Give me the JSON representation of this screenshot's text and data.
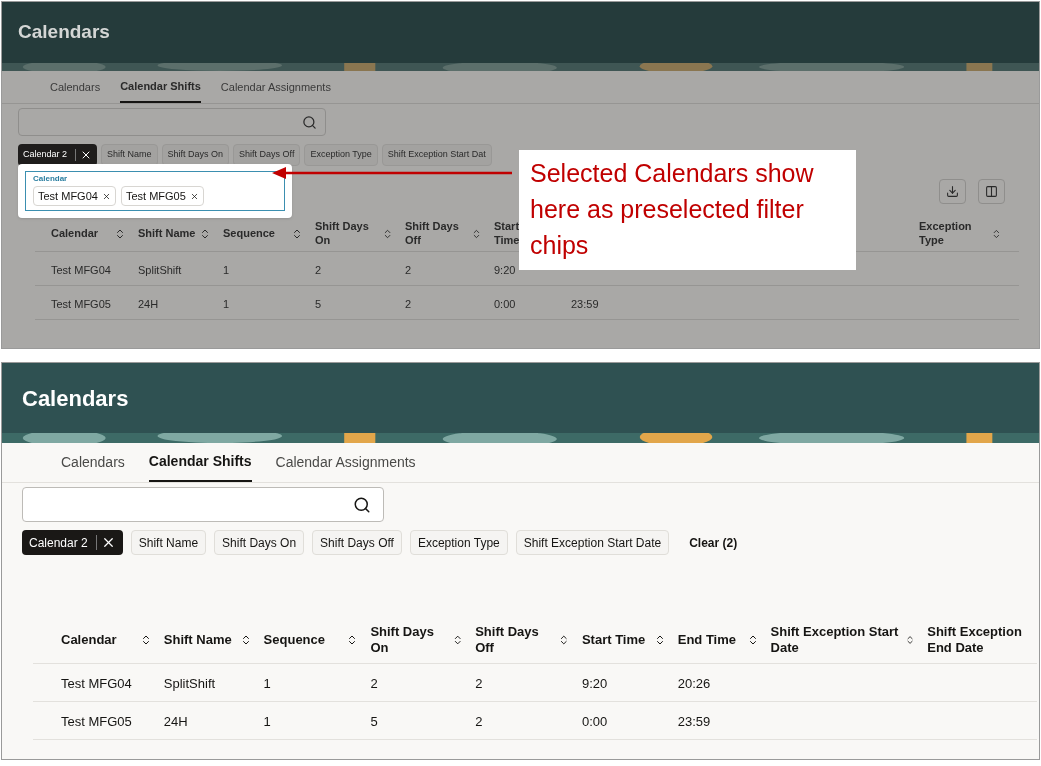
{
  "panels": [
    {
      "dimmed": true,
      "title": "Calendars",
      "tabs": [
        {
          "label": "Calendars",
          "selected": false
        },
        {
          "label": "Calendar Shifts",
          "selected": true
        },
        {
          "label": "Calendar Assignments",
          "selected": false
        }
      ],
      "filter_chips": [
        {
          "label": "Calendar 2",
          "selected": true
        },
        {
          "label": "Shift Name",
          "selected": false
        },
        {
          "label": "Shift Days On",
          "selected": false
        },
        {
          "label": "Shift Days Off",
          "selected": false
        },
        {
          "label": "Exception Type",
          "selected": false
        },
        {
          "label": "Shift Exception Start Dat",
          "selected": false
        }
      ],
      "popup": {
        "label": "Calendar",
        "chips": [
          "Test MFG04",
          "Test MFG05"
        ]
      },
      "tools": [
        {
          "kind": "download"
        },
        {
          "kind": "columns"
        }
      ],
      "table": {
        "columns": [
          "Calendar",
          "Shift Name",
          "Sequence",
          "Shift Days On",
          "Shift Days Off",
          "Start Time",
          null,
          null,
          "Exception Type"
        ],
        "rows": [
          [
            "Test MFG04",
            "SplitShift",
            "1",
            "2",
            "2",
            "9:20",
            null,
            null,
            null
          ],
          [
            "Test MFG05",
            "24H",
            "1",
            "5",
            "2",
            "0:00",
            "23:59",
            null,
            null
          ]
        ]
      }
    },
    {
      "dimmed": false,
      "title": "Calendars",
      "tabs": [
        {
          "label": "Calendars",
          "selected": false
        },
        {
          "label": "Calendar Shifts",
          "selected": true
        },
        {
          "label": "Calendar Assignments",
          "selected": false
        }
      ],
      "filter_chips": [
        {
          "label": "Calendar 2",
          "selected": true
        },
        {
          "label": "Shift Name",
          "selected": false
        },
        {
          "label": "Shift Days On",
          "selected": false
        },
        {
          "label": "Shift Days Off",
          "selected": false
        },
        {
          "label": "Exception Type",
          "selected": false
        },
        {
          "label": "Shift Exception Start Date",
          "selected": false
        }
      ],
      "clear_link": "Clear (2)",
      "table": {
        "columns": [
          "Calendar",
          "Shift Name",
          "Sequence",
          "Shift Days On",
          "Shift Days Off",
          "Start Time",
          "End Time",
          "Shift Exception Start Date",
          "Shift Exception End Date"
        ],
        "rows": [
          [
            "Test MFG04",
            "SplitShift",
            "1",
            "2",
            "2",
            "9:20",
            "20:26",
            null,
            null
          ],
          [
            "Test MFG05",
            "24H",
            "1",
            "5",
            "2",
            "0:00",
            "23:59",
            null,
            null
          ]
        ]
      }
    }
  ],
  "annotation": {
    "text": "Selected Calendars show here as preselected filter chips"
  }
}
